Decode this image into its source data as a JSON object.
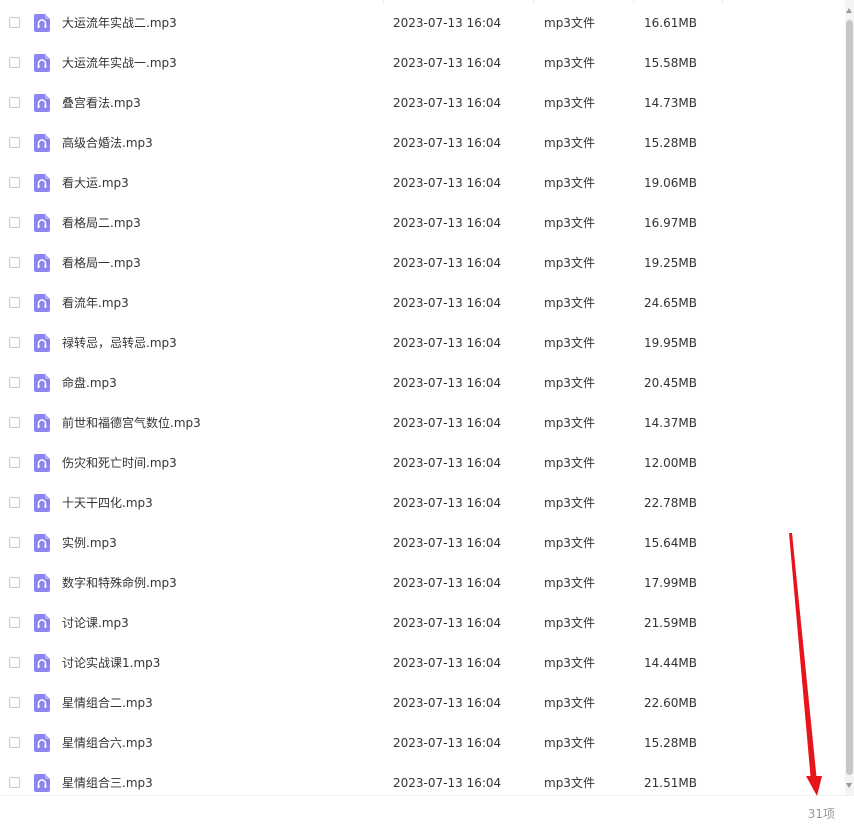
{
  "icons": {
    "file": "audio-file-icon",
    "checkbox": "checkbox"
  },
  "colors": {
    "file_icon": "#8c85f0",
    "annotation_arrow": "#e8141b",
    "count_text": "#999999"
  },
  "files": [
    {
      "name": "大运流年实战二.mp3",
      "modified": "2023-07-13 16:04",
      "type": "mp3文件",
      "size": "16.61MB"
    },
    {
      "name": "大运流年实战一.mp3",
      "modified": "2023-07-13 16:04",
      "type": "mp3文件",
      "size": "15.58MB"
    },
    {
      "name": "叠宫看法.mp3",
      "modified": "2023-07-13 16:04",
      "type": "mp3文件",
      "size": "14.73MB"
    },
    {
      "name": "高级合婚法.mp3",
      "modified": "2023-07-13 16:04",
      "type": "mp3文件",
      "size": "15.28MB"
    },
    {
      "name": "看大运.mp3",
      "modified": "2023-07-13 16:04",
      "type": "mp3文件",
      "size": "19.06MB"
    },
    {
      "name": "看格局二.mp3",
      "modified": "2023-07-13 16:04",
      "type": "mp3文件",
      "size": "16.97MB"
    },
    {
      "name": "看格局一.mp3",
      "modified": "2023-07-13 16:04",
      "type": "mp3文件",
      "size": "19.25MB"
    },
    {
      "name": "看流年.mp3",
      "modified": "2023-07-13 16:04",
      "type": "mp3文件",
      "size": "24.65MB"
    },
    {
      "name": "禄转忌，忌转忌.mp3",
      "modified": "2023-07-13 16:04",
      "type": "mp3文件",
      "size": "19.95MB"
    },
    {
      "name": "命盘.mp3",
      "modified": "2023-07-13 16:04",
      "type": "mp3文件",
      "size": "20.45MB"
    },
    {
      "name": "前世和福德宫气数位.mp3",
      "modified": "2023-07-13 16:04",
      "type": "mp3文件",
      "size": "14.37MB"
    },
    {
      "name": "伤灾和死亡时间.mp3",
      "modified": "2023-07-13 16:04",
      "type": "mp3文件",
      "size": "12.00MB"
    },
    {
      "name": "十天干四化.mp3",
      "modified": "2023-07-13 16:04",
      "type": "mp3文件",
      "size": "22.78MB"
    },
    {
      "name": "实例.mp3",
      "modified": "2023-07-13 16:04",
      "type": "mp3文件",
      "size": "15.64MB"
    },
    {
      "name": "数字和特殊命例.mp3",
      "modified": "2023-07-13 16:04",
      "type": "mp3文件",
      "size": "17.99MB"
    },
    {
      "name": "讨论课.mp3",
      "modified": "2023-07-13 16:04",
      "type": "mp3文件",
      "size": "21.59MB"
    },
    {
      "name": "讨论实战课1.mp3",
      "modified": "2023-07-13 16:04",
      "type": "mp3文件",
      "size": "14.44MB"
    },
    {
      "name": "星情组合二.mp3",
      "modified": "2023-07-13 16:04",
      "type": "mp3文件",
      "size": "22.60MB"
    },
    {
      "name": "星情组合六.mp3",
      "modified": "2023-07-13 16:04",
      "type": "mp3文件",
      "size": "15.28MB"
    },
    {
      "name": "星情组合三.mp3",
      "modified": "2023-07-13 16:04",
      "type": "mp3文件",
      "size": "21.51MB"
    }
  ],
  "footer": {
    "item_count": "31项"
  }
}
